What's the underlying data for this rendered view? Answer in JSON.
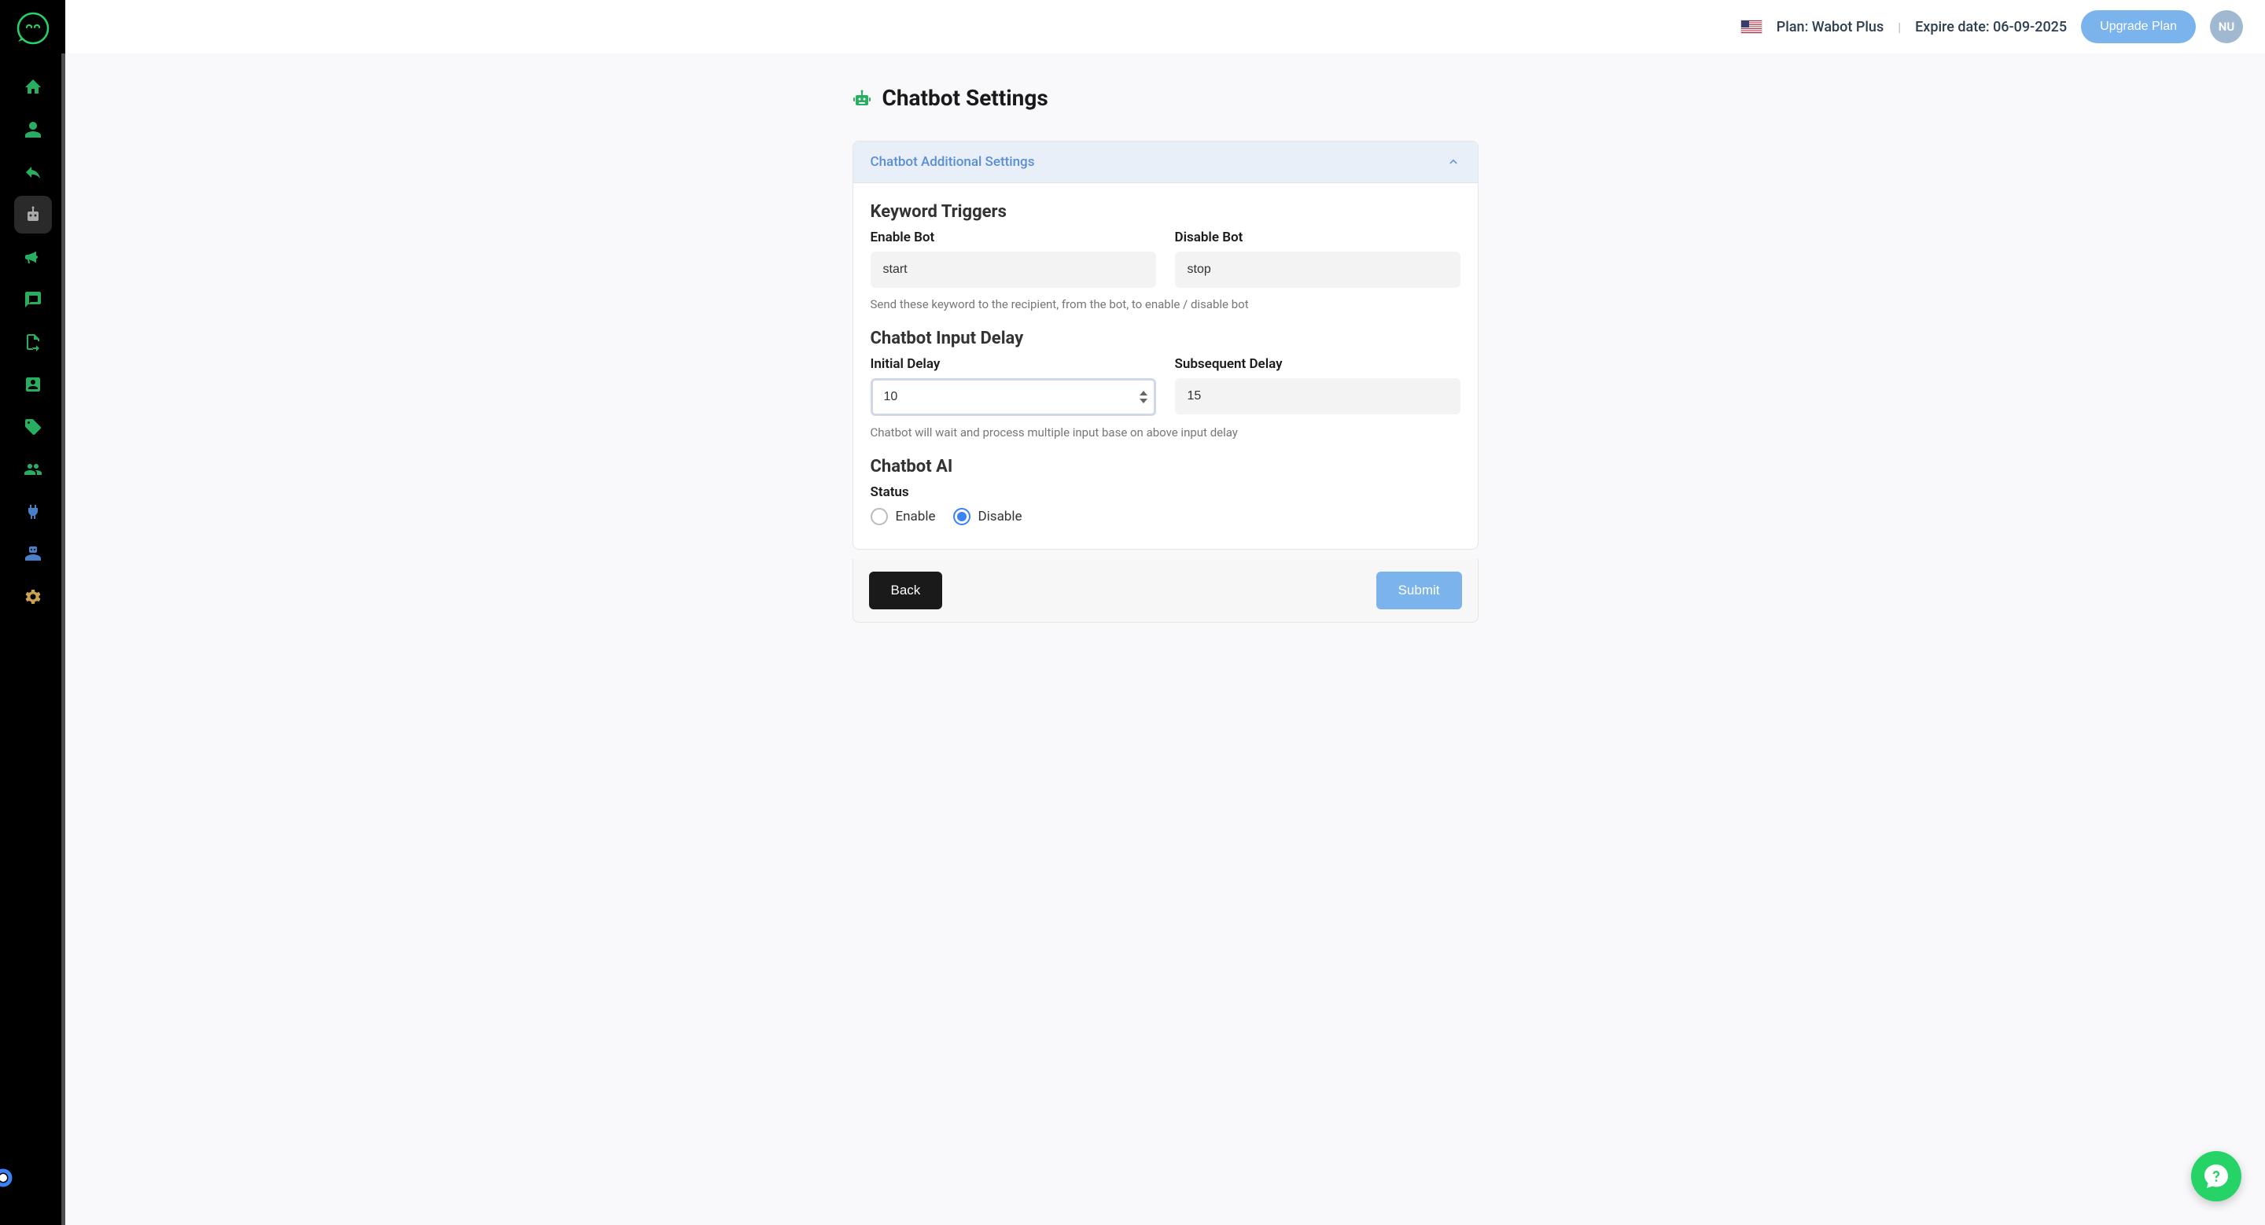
{
  "header": {
    "plan_label": "Plan: Wabot Plus",
    "expire_label": "Expire date: 06-09-2025",
    "upgrade_label": "Upgrade Plan",
    "avatar_initials": "NU"
  },
  "page": {
    "title": "Chatbot Settings"
  },
  "card": {
    "header_label": "Chatbot Additional Settings"
  },
  "keyword_triggers": {
    "section_title": "Keyword Triggers",
    "enable_label": "Enable Bot",
    "enable_value": "start",
    "disable_label": "Disable Bot",
    "disable_value": "stop",
    "help_text": "Send these keyword to the recipient, from the bot, to enable / disable bot"
  },
  "input_delay": {
    "section_title": "Chatbot Input Delay",
    "initial_label": "Initial Delay",
    "initial_value": "10",
    "subsequent_label": "Subsequent Delay",
    "subsequent_value": "15",
    "help_text": "Chatbot will wait and process multiple input base on above input delay"
  },
  "ai": {
    "section_title": "Chatbot AI",
    "status_label": "Status",
    "enable_label": "Enable",
    "disable_label": "Disable",
    "selected": "disable"
  },
  "buttons": {
    "back_label": "Back",
    "submit_label": "Submit"
  }
}
